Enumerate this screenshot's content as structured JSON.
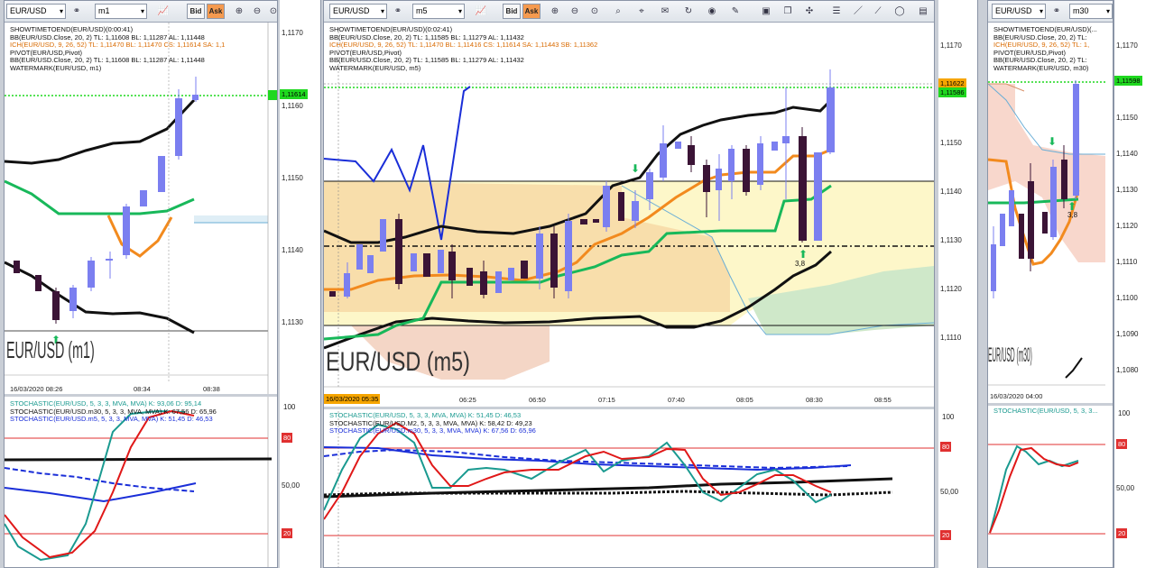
{
  "colors": {
    "bull": "#7b7ff0",
    "bear": "#3b1436",
    "ma": "#111111",
    "bbmid": "#f28a1e",
    "kijun": "#18b85a",
    "pivot": "#111111",
    "green_line": "#1fd81f",
    "orange_tag": "#f6a500",
    "stoch_k": "#1a9a90",
    "stoch_d": "#e01818",
    "stoch_blue": "#1a2ed8",
    "ref": "#e03030"
  },
  "panels": [
    {
      "id": "m1",
      "toolbar": {
        "symbol": "EUR/USD",
        "timeframe": "m1",
        "bid": "Bid",
        "ask": "Ask"
      },
      "info": [
        {
          "text": "SHOWTIMETOEND(EUR/USD)(0:00:41)",
          "color": "#111"
        },
        {
          "text": "BB(EUR/USD.Close, 20, 2)  TL: 1,11608  BL: 1,11287  AL: 1,11448",
          "color": "#111"
        },
        {
          "text": "ICH(EUR/USD, 9, 26, 52)  TL: 1,11470  BL: 1,11470  CS: 1,11614  SA: 1,1",
          "color": "#d96a00"
        },
        {
          "text": "PIVOT(EUR/USD,Pivot)",
          "color": "#111"
        },
        {
          "text": "BB(EUR/USD.Close, 20, 2)  TL: 1,11608  BL: 1,11287  AL: 1,11448",
          "color": "#111"
        },
        {
          "text": "WATERMARK(EUR/USD, m1)",
          "color": "#111"
        }
      ],
      "yaxis": [
        "1,1170",
        "1,1160",
        "1,1150",
        "1,1140",
        "1,1130"
      ],
      "price_tag": "1,11614",
      "xaxis": [
        "16/03/2020 08:26",
        "08:34",
        "08:38"
      ],
      "watermark": "EUR/USD (m1)",
      "stoch_info": [
        {
          "text": "STOCHASTIC(EUR/USD, 5, 3, 3, MVA, MVA)  K: 93,06  D: 95,14",
          "color": "#1a9a90"
        },
        {
          "text": "STOCHASTIC(EUR/USD.m30, 5, 3, 3, MVA, MVA)  K: 67,56  D: 65,96",
          "color": "#111"
        },
        {
          "text": "STOCHASTIC(EUR/USD.m5, 5, 3, 3, MVA, MVA)  K: 51,45  D: 46,53",
          "color": "#1a2ed8"
        }
      ],
      "stoch_axis": [
        "100",
        "80",
        "50,00",
        "20"
      ]
    },
    {
      "id": "m5",
      "toolbar": {
        "symbol": "EUR/USD",
        "timeframe": "m5",
        "bid": "Bid",
        "ask": "Ask"
      },
      "info": [
        {
          "text": "SHOWTIMETOEND(EUR/USD)(0:02:41)",
          "color": "#111"
        },
        {
          "text": "BB(EUR/USD.Close, 20, 2)  TL: 1,11585  BL: 1,11279  AL: 1,11432",
          "color": "#111"
        },
        {
          "text": "ICH(EUR/USD, 9, 26, 52)  TL: 1,11470  BL: 1,11416  CS: 1,11614  SA: 1,11443  SB: 1,11362",
          "color": "#d96a00"
        },
        {
          "text": "PIVOT(EUR/USD,Pivot)",
          "color": "#111"
        },
        {
          "text": "BB(EUR/USD.Close, 20, 2)  TL: 1,11585  BL: 1,11279  AL: 1,11432",
          "color": "#111"
        },
        {
          "text": "WATERMARK(EUR/USD, m5)",
          "color": "#111"
        }
      ],
      "yaxis": [
        "1,1170",
        "1,1160",
        "1,1150",
        "1,1140",
        "1,1130",
        "1,1120",
        "1,1110"
      ],
      "price_tag": "1,11622",
      "price_tag2": "1,11586",
      "xaxis": [
        "16/03/2020 05:35",
        "06:25",
        "06:50",
        "07:15",
        "07:40",
        "08:05",
        "08:30",
        "08:55"
      ],
      "watermark": "EUR/USD (m5)",
      "annotation": "3,8",
      "stoch_info": [
        {
          "text": "STOCHASTIC(EUR/USD, 5, 3, 3, MVA, MVA)  K: 51,45  D: 46,53",
          "color": "#1a9a90"
        },
        {
          "text": "STOCHASTIC(EUR/USD.M2, 5, 3, 3, MVA, MVA)  K: 58,42  D: 49,23",
          "color": "#111"
        },
        {
          "text": "STOCHASTIC(EUR/USD.m30, 5, 3, 3, MVA, MVA)  K: 67,56  D: 65,96",
          "color": "#1a2ed8"
        }
      ],
      "stoch_axis": [
        "100",
        "80",
        "50,00",
        "20"
      ]
    },
    {
      "id": "m30",
      "toolbar": {
        "symbol": "EUR/USD",
        "timeframe": "m30"
      },
      "info": [
        {
          "text": "SHOWTIMETOEND(EUR/USD)(...",
          "color": "#111"
        },
        {
          "text": "BB(EUR/USD.Close, 20, 2)  TL:",
          "color": "#111"
        },
        {
          "text": "ICH(EUR/USD, 9, 26, 52)  TL: 1,",
          "color": "#d96a00"
        },
        {
          "text": "PIVOT(EUR/USD,Pivot)",
          "color": "#111"
        },
        {
          "text": "BB(EUR/USD.Close, 20, 2)  TL:",
          "color": "#111"
        },
        {
          "text": "WATERMARK(EUR/USD, m30)",
          "color": "#111"
        }
      ],
      "yaxis": [
        "1,1170",
        "1,1160",
        "1,1150",
        "1,1140",
        "1,1130",
        "1,1120",
        "1,1110",
        "1,1100",
        "1,1090",
        "1,1080"
      ],
      "price_tag": "1,11598",
      "xaxis": [
        "16/03/2020 04:00"
      ],
      "watermark": "EUR/USD (m30)",
      "annotation": "3,8",
      "stoch_info": [
        {
          "text": "STOCHASTIC(EUR/USD, 5, 3, 3...",
          "color": "#1a9a90"
        }
      ],
      "stoch_axis": [
        "100",
        "80",
        "50,00",
        "20"
      ]
    }
  ]
}
